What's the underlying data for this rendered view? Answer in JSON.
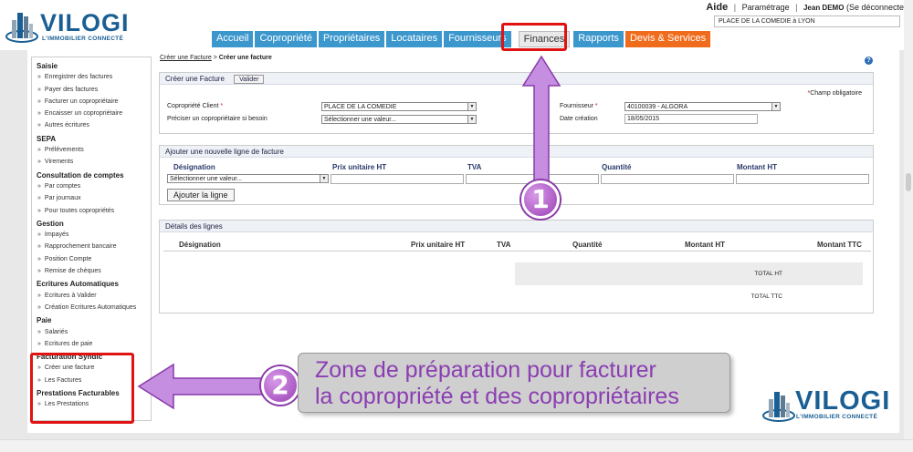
{
  "header": {
    "logo_text": "VILOGI",
    "logo_tagline": "L'IMMOBILIER CONNECTÉ",
    "top_links": {
      "help": "Aide",
      "settings": "Paramétrage",
      "user_name": "Jean DEMO",
      "logout": "(Se déconnecter)"
    },
    "address": "PLACE DE LA COMEDIE à LYON"
  },
  "nav": {
    "tabs": [
      {
        "label": "Accueil"
      },
      {
        "label": "Copropriété"
      },
      {
        "label": "Propriétaires"
      },
      {
        "label": "Locataires"
      },
      {
        "label": "Fournisseurs"
      },
      {
        "label": "Finances",
        "active": true
      },
      {
        "label": "Rapports"
      },
      {
        "label": "Devis & Services",
        "color": "#f06c1d"
      }
    ]
  },
  "sidebar": {
    "groups": [
      {
        "title": "Saisie",
        "items": [
          "Enregistrer des factures",
          "Payer des factures",
          "Facturer un copropriétaire",
          "Encaisser un copropriétaire",
          "Autres écritures"
        ]
      },
      {
        "title": "SEPA",
        "items": [
          "Prélèvements",
          "Virements"
        ]
      },
      {
        "title": "Consultation de comptes",
        "items": [
          "Par comptes",
          "Par journaux",
          "Pour toutes copropriétés"
        ]
      },
      {
        "title": "Gestion",
        "items": [
          "Impayés",
          "Rapprochement bancaire",
          "Position Compte",
          "Remise de chèques"
        ]
      },
      {
        "title": "Ecritures Automatiques",
        "items": [
          "Ecritures à Valider",
          "Création Ecritures Automatiques"
        ]
      },
      {
        "title": "Paie",
        "items": [
          "Salariés",
          "Ecritures de paie"
        ]
      },
      {
        "title": "Facturation Syndic",
        "items": [
          "Créer une facture",
          "Les Factures"
        ]
      },
      {
        "title": "Prestations Facturables",
        "items": [
          "Les Prestations"
        ]
      }
    ]
  },
  "breadcrumb": {
    "link": "Créer une Facture",
    "separator": " > ",
    "current": "Créer une facture"
  },
  "help_icon": "?",
  "create_panel": {
    "title": "Créer une Facture",
    "validate_button": "Valider",
    "required_note": "Champ obligatoire",
    "required_mark": "*",
    "client_label": "Copropriété Client",
    "client_value": "PLACE DE LA COMEDIE",
    "coowner_label": "Préciser un copropriétaire si besoin",
    "coowner_value": "Sélectionner une valeur...",
    "supplier_label": "Fournisseur",
    "supplier_value": "40100039 - ALGORA",
    "date_label": "Date création",
    "date_value": "18/05/2015"
  },
  "line_panel": {
    "title": "Ajouter une nouvelle ligne de facture",
    "columns": [
      "Désignation",
      "Prix unitaire HT",
      "TVA",
      "Quantité",
      "Montant HT"
    ],
    "designation_select": "Sélectionner une valeur...",
    "add_button": "Ajouter la ligne"
  },
  "details_panel": {
    "title": "Détails des lignes",
    "columns": [
      "Désignation",
      "Prix unitaire HT",
      "TVA",
      "Quantité",
      "Montant HT",
      "Montant TTC"
    ],
    "total_ht": "TOTAL HT",
    "total_ttc": "TOTAL TTC"
  },
  "annotations": {
    "badge_1": "1",
    "badge_2": "2",
    "callout_line_1": "Zone de préparation pour facturer",
    "callout_line_2": "la copropriété et des copropriétaires",
    "highlight_color": "#e01212",
    "accent_color": "#9a3fb5"
  }
}
